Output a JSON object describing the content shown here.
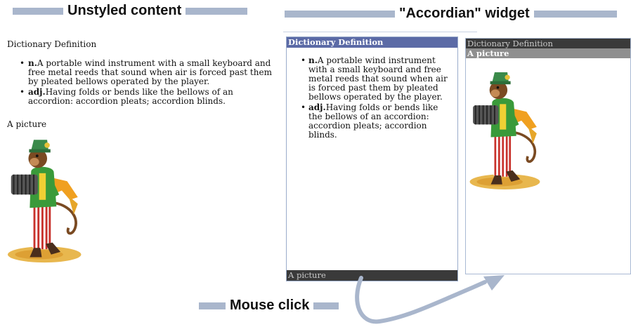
{
  "banners": {
    "left_title": "Unstyled content",
    "right_title": "\"Accordian\" widget",
    "bottom_title": "Mouse click"
  },
  "unstyled": {
    "heading": "Dictionary Definition",
    "definitions": [
      {
        "pos": "n.",
        "text": "A portable wind instrument with a small keyboard and free metal reeds that sound when air is forced past them by pleated bellows operated by the player."
      },
      {
        "pos": "adj.",
        "text": "Having folds or bends like the bellows of an accordion: accordion pleats; accordion blinds."
      }
    ],
    "picture_label": "A picture"
  },
  "accordion_definition_open": {
    "open_header": "Dictionary Definition",
    "definitions": [
      {
        "pos": "n.",
        "text": "A portable wind instrument with a small keyboard and free metal reeds that sound when air is forced past them by pleated bellows operated by the player."
      },
      {
        "pos": "adj.",
        "text": "Having folds or bends like the bellows of an accordion: accordion pleats; accordion blinds."
      }
    ],
    "closed_header": "A picture"
  },
  "accordion_picture_open": {
    "closed_header": "Dictionary Definition",
    "open_header": "A picture"
  },
  "image": {
    "name": "accordion-monkey-image"
  },
  "colors": {
    "banner_bar": "#a9b6cc",
    "open_header": "#5b6aa6",
    "closed_header": "#3a3a3a",
    "picture_header": "#8f8f8f",
    "arrow": "#a9b6cc"
  }
}
